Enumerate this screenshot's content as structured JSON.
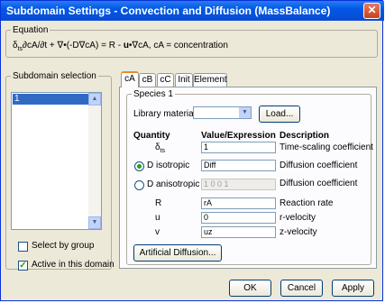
{
  "window": {
    "title": "Subdomain Settings - Convection and Diffusion (MassBalance)"
  },
  "equation": {
    "legend": "Equation",
    "text": "δts∂cA/∂t + ∇•(-D∇cA) = R - u•∇cA, cA = concentration"
  },
  "subdomain_selection": {
    "legend": "Subdomain selection",
    "items": [
      "1"
    ],
    "select_by_group": "Select by group",
    "active_in_domain": "Active in this domain"
  },
  "tabs": [
    "cA",
    "cB",
    "cC",
    "Init",
    "Element"
  ],
  "species": {
    "legend": "Species 1",
    "library_label": "Library material:",
    "library_value": "",
    "load_button": "Load...",
    "headers": {
      "quantity": "Quantity",
      "value": "Value/Expression",
      "description": "Description"
    },
    "rows": [
      {
        "quantity": "δts",
        "value": "1",
        "description": "Time-scaling coefficient"
      },
      {
        "quantity": "D isotropic",
        "value": "Diff",
        "description": "Diffusion coefficient"
      },
      {
        "quantity": "D anisotropic",
        "value": "1 0 0 1",
        "description": "Diffusion coefficient"
      },
      {
        "quantity": "R",
        "value": "rA",
        "description": "Reaction rate"
      },
      {
        "quantity": "u",
        "value": "0",
        "description": "r-velocity"
      },
      {
        "quantity": "v",
        "value": "uz",
        "description": "z-velocity"
      }
    ],
    "artificial_button": "Artificial Diffusion..."
  },
  "buttons": {
    "ok": "OK",
    "cancel": "Cancel",
    "apply": "Apply"
  },
  "icons": {
    "close": "close-icon",
    "dropdown": "chevron-down-icon"
  }
}
